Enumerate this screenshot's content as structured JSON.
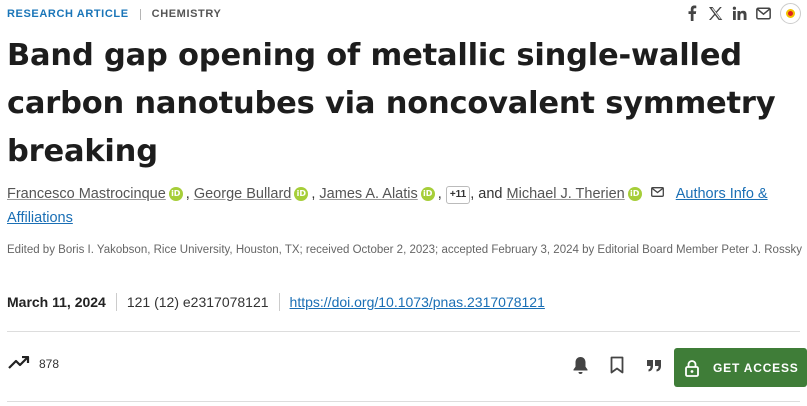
{
  "header": {
    "article_type": "RESEARCH ARTICLE",
    "subject": "CHEMISTRY"
  },
  "share_icons": [
    "facebook-icon",
    "x-icon",
    "linkedin-icon",
    "email-icon",
    "check-for-updates-icon"
  ],
  "title": "Band gap opening of metallic single-walled carbon nanotubes via noncovalent symmetry breaking",
  "authors": {
    "list": [
      "Francesco Mastrocinque",
      "George Bullard",
      "James A. Alatis"
    ],
    "more_count": "+11",
    "conjunction": ", and",
    "last": "Michael J. Therien",
    "info_link": "Authors Info & Affiliations"
  },
  "edited_by": "Edited by Boris I. Yakobson, Rice University, Houston, TX; received October 2, 2023; accepted February 3, 2024 by Editorial Board Member Peter J. Rossky",
  "meta": {
    "date": "March 11, 2024",
    "citation": "121 (12) e2317078121",
    "doi": "https://doi.org/10.1073/pnas.2317078121"
  },
  "metrics": {
    "count": "878",
    "icon": "trending-up-icon"
  },
  "actions": [
    "bell-icon",
    "bookmark-icon",
    "quote-icon"
  ],
  "access_button": {
    "label": "GET ACCESS",
    "color": "#3f7d38"
  },
  "colors": {
    "link": "#1a6fb5",
    "orcid": "#a6ce39"
  }
}
